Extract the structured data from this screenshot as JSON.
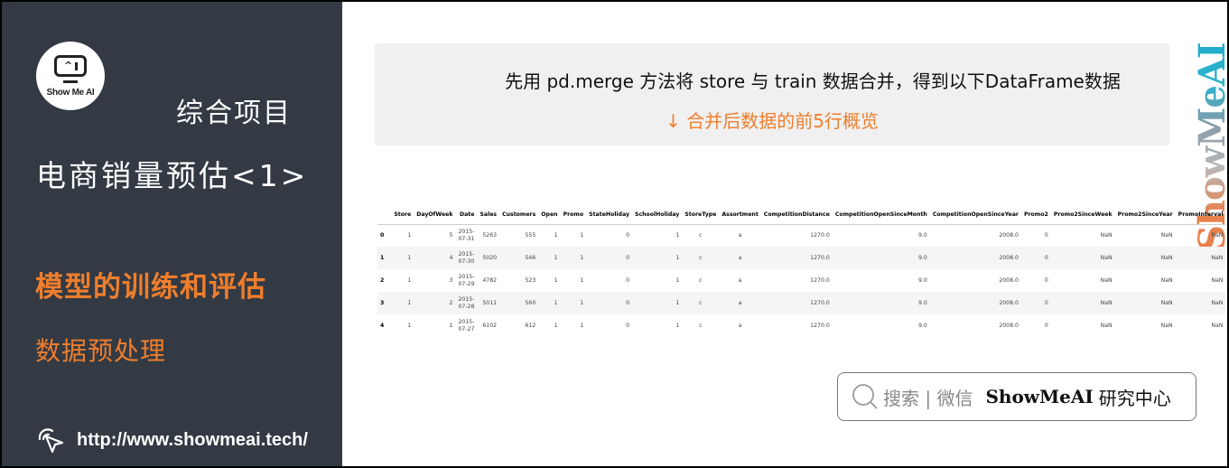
{
  "sidebar": {
    "logo_text": "Show Me AI",
    "section_title": "综合项目",
    "course_title": "电商销量预估<1>",
    "chapter_title": "模型的训练和评估",
    "topic_title": "数据预处理",
    "url": "http://www.showmeai.tech/",
    "url_icon": "cursor-click-icon"
  },
  "banner": {
    "line1": "先用 pd.merge 方法将 store 与 train 数据合并，得到以下DataFrame数据",
    "line2": "↓ 合并后数据的前5行概览"
  },
  "watermark": "ShowMeAI",
  "dataframe": {
    "columns": [
      "",
      "Store",
      "DayOfWeek",
      "Date",
      "Sales",
      "Customers",
      "Open",
      "Promo",
      "StateHoliday",
      "SchoolHoliday",
      "StoreType",
      "Assortment",
      "CompetitionDistance",
      "CompetitionOpenSinceMonth",
      "CompetitionOpenSinceYear",
      "Promo2",
      "Promo2SinceWeek",
      "Promo2SinceYear",
      "PromoInterval"
    ],
    "rows": [
      [
        "0",
        "1",
        "5",
        "2015-07-31",
        "5263",
        "555",
        "1",
        "1",
        "0",
        "1",
        "c",
        "a",
        "1270.0",
        "9.0",
        "2008.0",
        "0",
        "NaN",
        "NaN",
        "NaN"
      ],
      [
        "1",
        "1",
        "4",
        "2015-07-30",
        "5020",
        "546",
        "1",
        "1",
        "0",
        "1",
        "c",
        "a",
        "1270.0",
        "9.0",
        "2008.0",
        "0",
        "NaN",
        "NaN",
        "NaN"
      ],
      [
        "2",
        "1",
        "3",
        "2015-07-29",
        "4782",
        "523",
        "1",
        "1",
        "0",
        "1",
        "c",
        "a",
        "1270.0",
        "9.0",
        "2008.0",
        "0",
        "NaN",
        "NaN",
        "NaN"
      ],
      [
        "3",
        "1",
        "2",
        "2015-07-28",
        "5011",
        "560",
        "1",
        "1",
        "0",
        "1",
        "c",
        "a",
        "1270.0",
        "9.0",
        "2008.0",
        "0",
        "NaN",
        "NaN",
        "NaN"
      ],
      [
        "4",
        "1",
        "1",
        "2015-07-27",
        "6102",
        "612",
        "1",
        "1",
        "0",
        "1",
        "c",
        "a",
        "1270.0",
        "9.0",
        "2008.0",
        "0",
        "NaN",
        "NaN",
        "NaN"
      ]
    ]
  },
  "search_box": {
    "icon": "search-icon",
    "hint": "搜索 | 微信",
    "brand": "ShowMeAI",
    "brand_suffix": "研究中心"
  },
  "colors": {
    "sidebar_bg": "#333a44",
    "accent_orange": "#f07e2c",
    "banner_bg": "#f0f0f0"
  }
}
